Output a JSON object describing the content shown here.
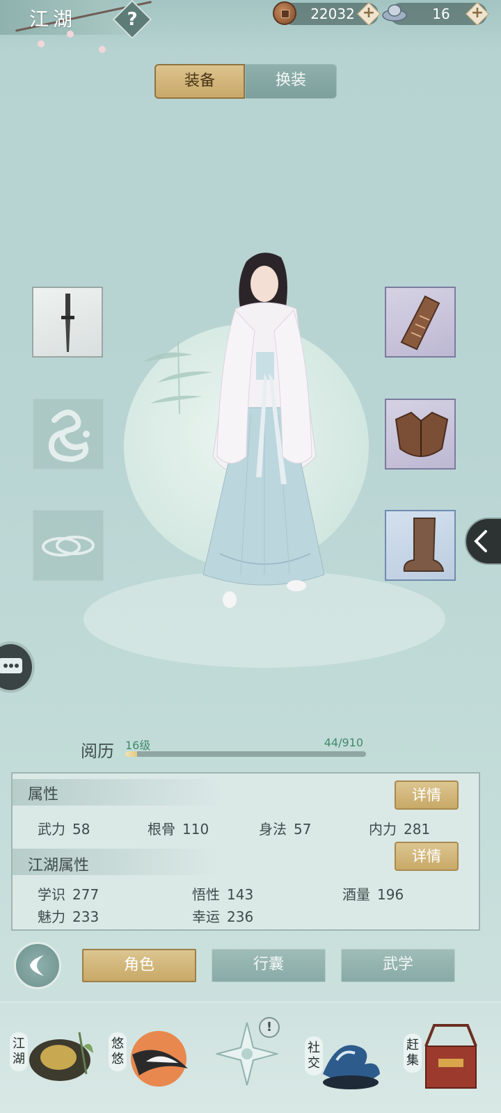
{
  "header": {
    "title": "江湖",
    "help_label": "?",
    "coins": "22032",
    "silver": "16",
    "plus_label": "+"
  },
  "tabs": [
    {
      "label": "装备",
      "active": true
    },
    {
      "label": "换装",
      "active": false
    }
  ],
  "equipment": {
    "left_slots": [
      "dagger-icon",
      "pendant-empty-icon",
      "ring-empty-icon"
    ],
    "right_slots": [
      "bracer-icon",
      "armor-icon",
      "boot-icon"
    ]
  },
  "experience": {
    "label": "阅历",
    "level": "16级",
    "progress_text": "44/910",
    "progress_fraction": 0.048
  },
  "attributes": {
    "section_title": "属性",
    "detail_label": "详情",
    "items": [
      {
        "name": "武力",
        "value": "58"
      },
      {
        "name": "根骨",
        "value": "110"
      },
      {
        "name": "身法",
        "value": "57"
      },
      {
        "name": "内力",
        "value": "281"
      }
    ]
  },
  "jianghu_attributes": {
    "section_title": "江湖属性",
    "detail_label": "详情",
    "items": [
      {
        "name": "学识",
        "value": "277"
      },
      {
        "name": "悟性",
        "value": "143"
      },
      {
        "name": "酒量",
        "value": "196"
      },
      {
        "name": "魅力",
        "value": "233"
      },
      {
        "name": "幸运",
        "value": "236"
      }
    ]
  },
  "actions": [
    {
      "label": "角色",
      "active": true
    },
    {
      "label": "行囊",
      "active": false
    },
    {
      "label": "武学",
      "active": false
    }
  ],
  "bottom_nav": [
    {
      "label": "江湖"
    },
    {
      "label": "悠悠"
    },
    {
      "label": "社交"
    },
    {
      "label": "赶集"
    }
  ],
  "nav_alert": "!",
  "colors": {
    "gold": "#c8a967",
    "teal": "#88aaa6",
    "background": "#b9d5d3"
  }
}
